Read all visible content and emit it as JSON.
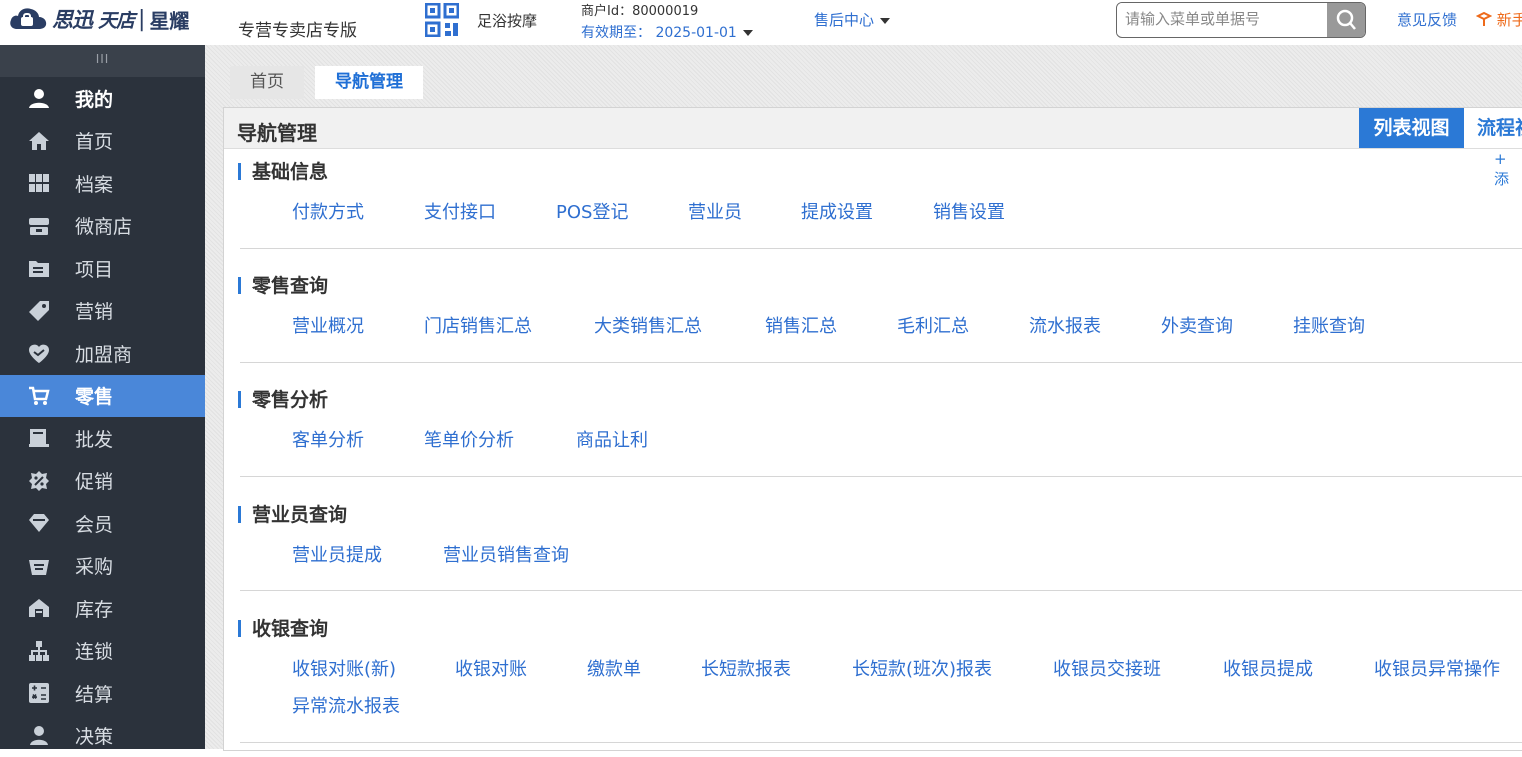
{
  "header": {
    "brand": "思迅",
    "brand2": "天店",
    "sub_brand": "星耀",
    "edition": "专营专卖店专版",
    "store_name": "足浴按摩",
    "merchant_id": "商户Id：80000019",
    "expiry": "有效期至： 2025-01-01",
    "after_sales": "售后中心",
    "search_placeholder": "请输入菜单或单据号",
    "feedback": "意见反馈",
    "newbie": "新手"
  },
  "sidebar": {
    "grip": "III",
    "items": [
      {
        "label": "我的",
        "icon": "user-icon"
      },
      {
        "label": "首页",
        "icon": "home-icon"
      },
      {
        "label": "档案",
        "icon": "archive-icon"
      },
      {
        "label": "微商店",
        "icon": "shop-icon"
      },
      {
        "label": "项目",
        "icon": "folder-icon"
      },
      {
        "label": "营销",
        "icon": "tag-icon"
      },
      {
        "label": "加盟商",
        "icon": "handshake-icon"
      },
      {
        "label": "零售",
        "icon": "cart-icon"
      },
      {
        "label": "批发",
        "icon": "truck-icon"
      },
      {
        "label": "促销",
        "icon": "discount-icon"
      },
      {
        "label": "会员",
        "icon": "diamond-icon"
      },
      {
        "label": "采购",
        "icon": "basket-icon"
      },
      {
        "label": "库存",
        "icon": "warehouse-icon"
      },
      {
        "label": "连锁",
        "icon": "chain-icon"
      },
      {
        "label": "结算",
        "icon": "calculator-icon"
      },
      {
        "label": "决策",
        "icon": "decision-icon"
      }
    ],
    "active": "零售"
  },
  "tabs": [
    {
      "label": "首页"
    },
    {
      "label": "导航管理"
    }
  ],
  "panel": {
    "title": "导航管理",
    "view_list": "列表视图",
    "view_flow": "流程视图",
    "add": "+ 添"
  },
  "sections": [
    {
      "title": "基础信息",
      "links": [
        "付款方式",
        "支付接口",
        "POS登记",
        "营业员",
        "提成设置",
        "销售设置"
      ]
    },
    {
      "title": "零售查询",
      "links": [
        "营业概况",
        "门店销售汇总",
        "大类销售汇总",
        "销售汇总",
        "毛利汇总",
        "流水报表",
        "外卖查询",
        "挂账查询"
      ]
    },
    {
      "title": "零售分析",
      "links": [
        "客单分析",
        "笔单价分析",
        "商品让利"
      ]
    },
    {
      "title": "营业员查询",
      "links": [
        "营业员提成",
        "营业员销售查询"
      ]
    },
    {
      "title": "收银查询",
      "links": [
        "收银对账(新)",
        "收银对账",
        "缴款单",
        "长短款报表",
        "长短款(班次)报表",
        "收银员交接班",
        "收银员提成",
        "收银员异常操作",
        "异常流水报表"
      ]
    }
  ],
  "colors": {
    "accent": "#2b79d6",
    "sidebar_bg": "#2b323c",
    "active_bg": "#4a87d9",
    "link": "#2f6fd0"
  }
}
